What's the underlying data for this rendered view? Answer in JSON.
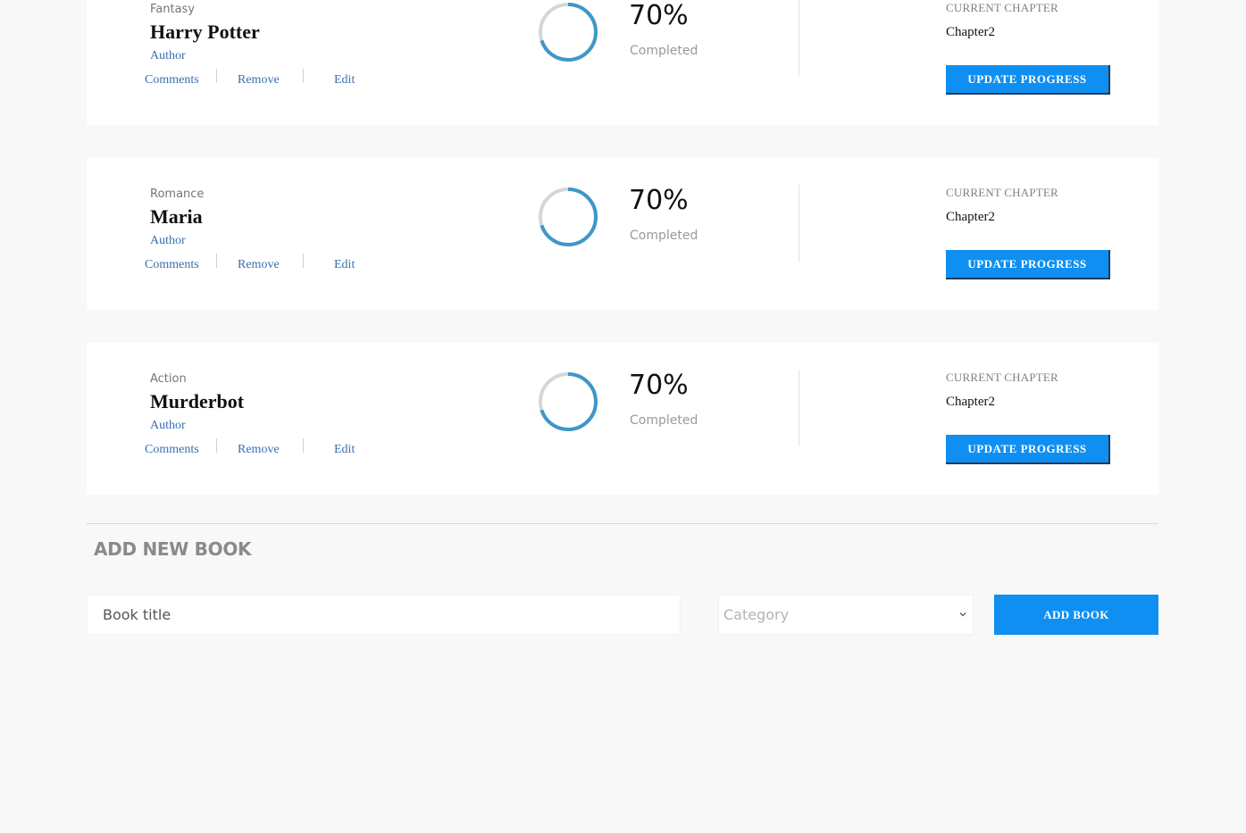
{
  "books": [
    {
      "category": "Fantasy",
      "title": "Harry Potter",
      "author": "Author",
      "actions": {
        "comments": "Comments",
        "remove": "Remove",
        "edit": "Edit"
      },
      "progress_text": "70%",
      "progress_fraction": 0.7,
      "completed_label": "Completed",
      "current_chapter_label": "CURRENT CHAPTER",
      "current_chapter": "Chapter2",
      "update_button": "UPDATE PROGRESS"
    },
    {
      "category": "Romance",
      "title": "Maria",
      "author": "Author",
      "actions": {
        "comments": "Comments",
        "remove": "Remove",
        "edit": "Edit"
      },
      "progress_text": "70%",
      "progress_fraction": 0.7,
      "completed_label": "Completed",
      "current_chapter_label": "CURRENT CHAPTER",
      "current_chapter": "Chapter2",
      "update_button": "UPDATE PROGRESS"
    },
    {
      "category": "Action",
      "title": "Murderbot",
      "author": "Author",
      "actions": {
        "comments": "Comments",
        "remove": "Remove",
        "edit": "Edit"
      },
      "progress_text": "70%",
      "progress_fraction": 0.7,
      "completed_label": "Completed",
      "current_chapter_label": "CURRENT CHAPTER",
      "current_chapter": "Chapter2",
      "update_button": "UPDATE PROGRESS"
    }
  ],
  "add_book": {
    "heading": "ADD NEW BOOK",
    "title_placeholder": "Book title",
    "category_placeholder": "Category",
    "button": "ADD BOOK"
  },
  "colors": {
    "accent": "#0f8ff2",
    "ring_progress": "#3e97c8",
    "ring_track": "#d6d6d6",
    "link": "#3a6fb0",
    "background": "#f8f8f8"
  },
  "icons": {
    "select_caret": "chevron-down-icon"
  }
}
